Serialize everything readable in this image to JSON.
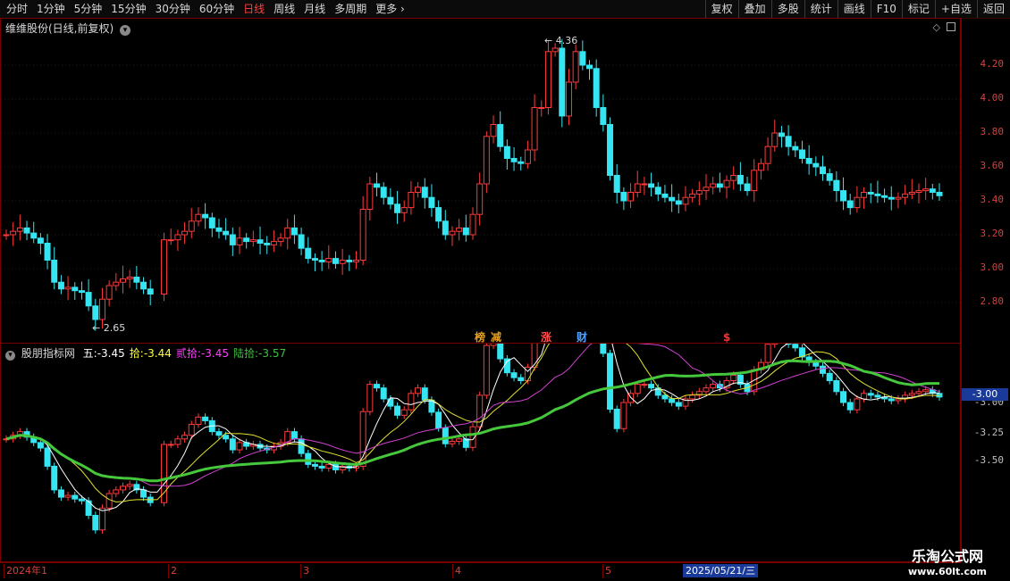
{
  "toolbar": {
    "periods": [
      "分时",
      "1分钟",
      "5分钟",
      "15分钟",
      "30分钟",
      "60分钟",
      "日线",
      "周线",
      "月线",
      "多周期",
      "更多"
    ],
    "active_period": "日线",
    "more_arrow": "›",
    "right_buttons": [
      "复权",
      "叠加",
      "多股",
      "统计",
      "画线",
      "F10",
      "标记",
      "+自选",
      "返回"
    ]
  },
  "main_chart": {
    "title": "维维股份(日线,前复权)",
    "high_label": "4.36",
    "low_label": "2.65",
    "y_ticks": [
      "4.20",
      "4.00",
      "3.80",
      "3.60",
      "3.40",
      "3.20",
      "3.00",
      "2.80"
    ],
    "event_badges": [
      {
        "text": "榜",
        "color": "#e8a020"
      },
      {
        "text": "减",
        "color": "#e8a020"
      },
      {
        "text": "涨",
        "color": "#ff5050"
      },
      {
        "text": "财",
        "color": "#50a0ff"
      },
      {
        "text": "$",
        "color": "#ff3030"
      }
    ]
  },
  "indicator": {
    "name": "股朋指标网",
    "items": [
      {
        "label": "五:",
        "value": "-3.45",
        "color": "#ffffff"
      },
      {
        "label": "拾:",
        "value": "-3.44",
        "color": "#ffff40"
      },
      {
        "label": "贰拾:",
        "value": "-3.45",
        "color": "#ff40ff"
      },
      {
        "label": "陆拾:",
        "value": "-3.57",
        "color": "#40c040"
      }
    ],
    "y_ticks": [
      "-3.00",
      "-3.25",
      "-3.50"
    ],
    "current_value": "-3.00"
  },
  "date_axis": {
    "labels": [
      "2024年1",
      "2",
      "3",
      "4",
      "5"
    ],
    "highlighted_date": "2025/05/21/三"
  },
  "watermark": {
    "line1": "乐淘公式网",
    "line2": "www.60lt.com"
  },
  "colors": {
    "up": "#ff3b3b",
    "down": "#35e6f2",
    "ma60": "#46c83c",
    "ma20": "#d040d0",
    "ma10": "#e0e030",
    "ma5": "#ffffff"
  }
}
